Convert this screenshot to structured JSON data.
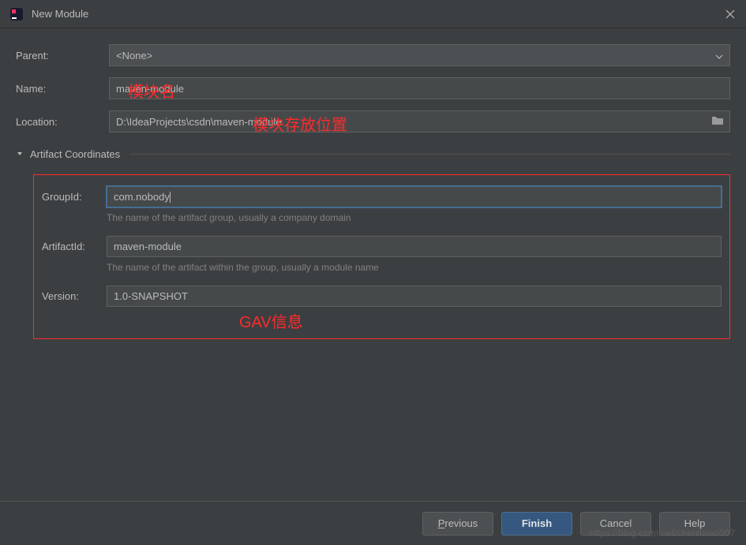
{
  "titlebar": {
    "title": "New Module"
  },
  "form": {
    "parent_label": "Parent:",
    "parent_value": "<None>",
    "name_label": "Name:",
    "name_value": "maven-module",
    "location_label": "Location:",
    "location_value": "D:\\IdeaProjects\\csdn\\maven-module"
  },
  "annotations": {
    "module_name": "模块名",
    "module_location": "模块存放位置",
    "gav_info": "GAV信息"
  },
  "section": {
    "title": "Artifact Coordinates"
  },
  "gav": {
    "groupid_label": "GroupId:",
    "groupid_value": "com.nobody",
    "groupid_hint": "The name of the artifact group, usually a company domain",
    "artifactid_label": "ArtifactId:",
    "artifactid_value": "maven-module",
    "artifactid_hint": "The name of the artifact within the group, usually a module name",
    "version_label": "Version:",
    "version_value": "1.0-SNAPSHOT"
  },
  "buttons": {
    "previous": "Previous",
    "finish": "Finish",
    "cancel": "Cancel",
    "help": "Help"
  },
  "watermark": "https://blog.csdn.net/chenlixiao007"
}
